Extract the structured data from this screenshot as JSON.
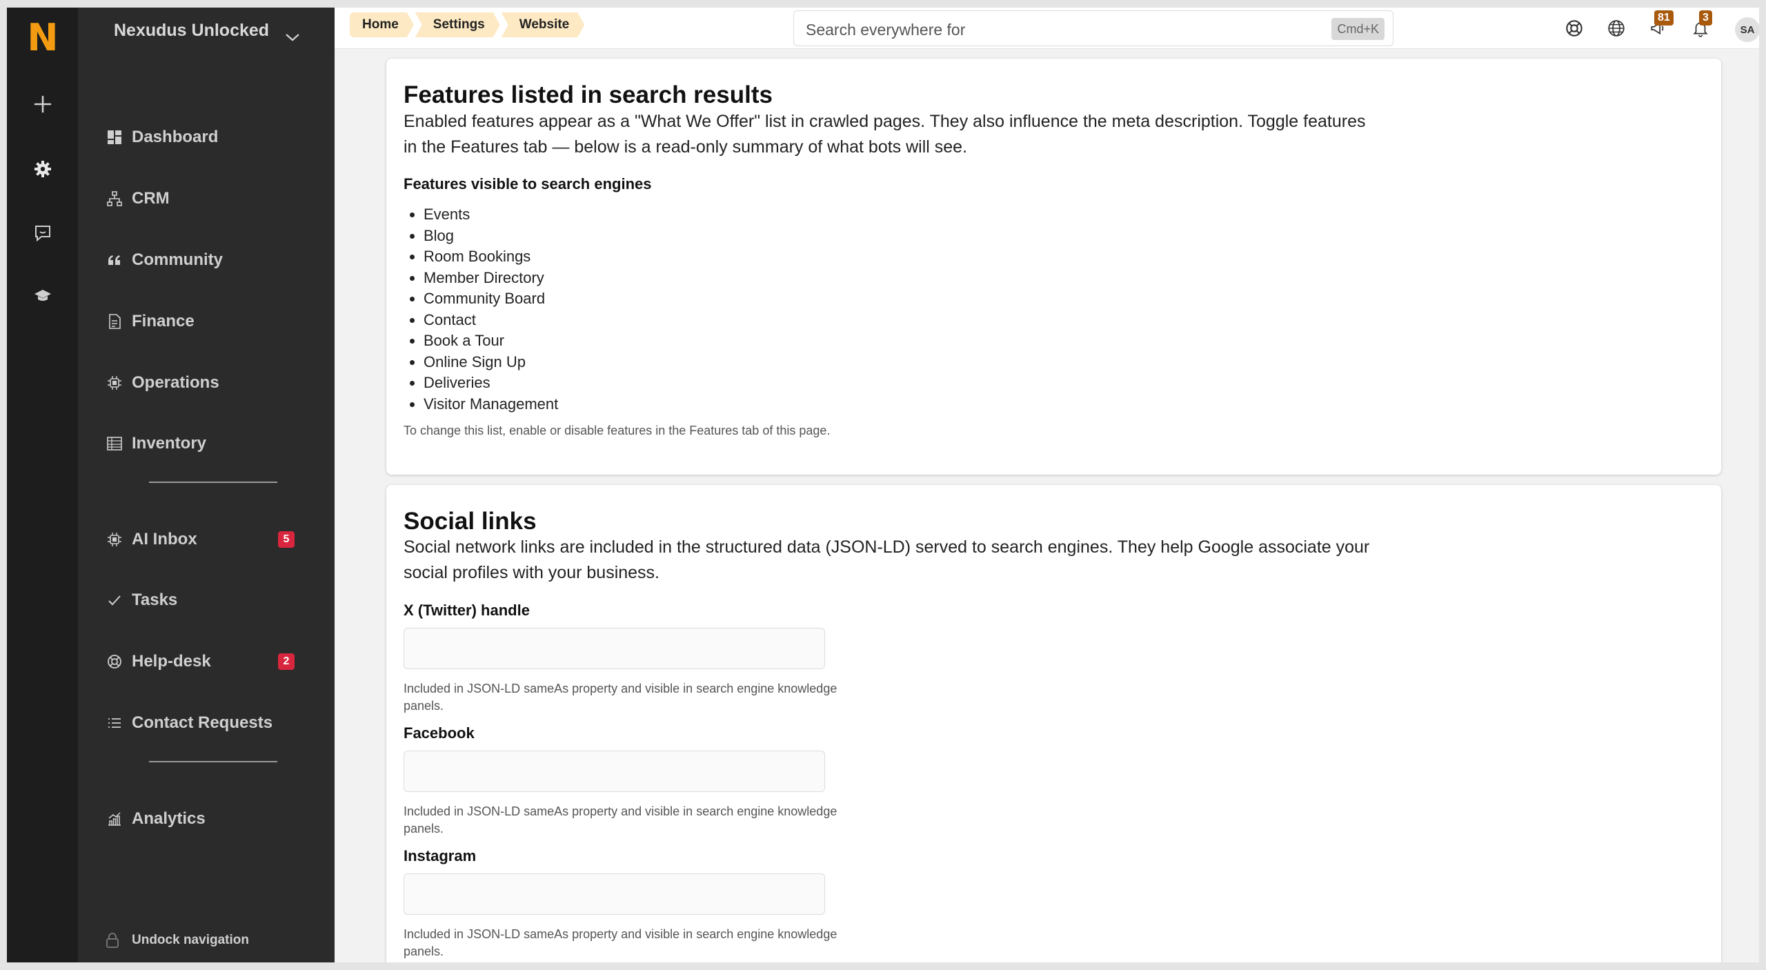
{
  "app": {
    "logo_letter": "N",
    "org_name": "Nexudus Unlocked"
  },
  "sidebar": {
    "items": [
      {
        "label": "Dashboard",
        "icon": "dashboard-icon"
      },
      {
        "label": "CRM",
        "icon": "org-chart-icon"
      },
      {
        "label": "Community",
        "icon": "quote-icon"
      },
      {
        "label": "Finance",
        "icon": "document-icon"
      },
      {
        "label": "Operations",
        "icon": "chip-icon"
      },
      {
        "label": "Inventory",
        "icon": "table-icon"
      },
      {
        "label": "AI Inbox",
        "icon": "chip-icon",
        "badge": "5"
      },
      {
        "label": "Tasks",
        "icon": "check-icon"
      },
      {
        "label": "Help-desk",
        "icon": "lifebuoy-icon",
        "badge": "2"
      },
      {
        "label": "Contact Requests",
        "icon": "list-icon"
      },
      {
        "label": "Analytics",
        "icon": "chart-icon"
      }
    ],
    "undock_label": "Undock navigation"
  },
  "breadcrumb": [
    "Home",
    "Settings",
    "Website"
  ],
  "search": {
    "placeholder": "Search everywhere for",
    "shortcut": "Cmd+K"
  },
  "top": {
    "notif_count_a": "81",
    "notif_count_b": "3",
    "avatar": "SA"
  },
  "features_card": {
    "title": "Features listed in search results",
    "description": "Enabled features appear as a \"What We Offer\" list in crawled pages. They also influence the meta description. Toggle features in the Features tab — below is a read-only summary of what bots will see.",
    "list_heading": "Features visible to search engines",
    "features": [
      "Events",
      "Blog",
      "Room Bookings",
      "Member Directory",
      "Community Board",
      "Contact",
      "Book a Tour",
      "Online Sign Up",
      "Deliveries",
      "Visitor Management"
    ],
    "hint": "To change this list, enable or disable features in the Features tab of this page."
  },
  "social_card": {
    "title": "Social links",
    "description": "Social network links are included in the structured data (JSON-LD) served to search engines. They help Google associate your social profiles with your business.",
    "fields": [
      {
        "label": "X (Twitter) handle",
        "value": "",
        "hint": "Included in JSON-LD sameAs property and visible in search engine knowledge panels."
      },
      {
        "label": "Facebook",
        "value": "",
        "hint": "Included in JSON-LD sameAs property and visible in search engine knowledge panels."
      },
      {
        "label": "Instagram",
        "value": "",
        "hint": "Included in JSON-LD sameAs property and visible in search engine knowledge panels."
      }
    ]
  },
  "colors": {
    "accent": "#f39c12",
    "badge": "#d7263d",
    "crumb_bg": "#fde9c3"
  }
}
